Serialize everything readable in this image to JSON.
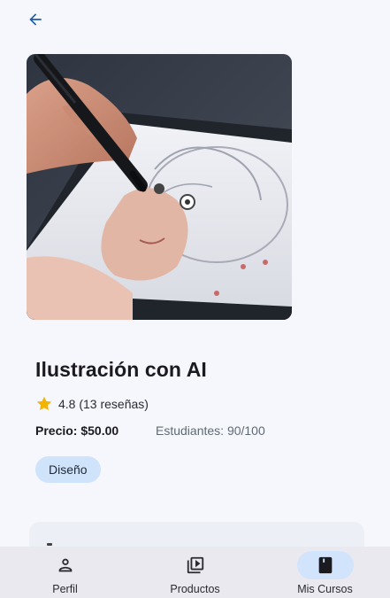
{
  "header": {
    "back_icon": "arrow-back-icon"
  },
  "course": {
    "image_alt": "Ilustración con AI",
    "title": "Ilustración con AI",
    "rating_icon": "star-icon",
    "rating_text": "4.8 (13 reseñas)",
    "price_text": "Precio: $50.00",
    "students_text": "Estudiantes: 90/100",
    "category_chip": "Diseño"
  },
  "bottom_nav": {
    "items": [
      {
        "label": "Perfil",
        "icon": "person-icon",
        "active": false
      },
      {
        "label": "Productos",
        "icon": "video-library-icon",
        "active": false
      },
      {
        "label": "Mis Cursos",
        "icon": "book-icon",
        "active": true
      }
    ]
  },
  "colors": {
    "accent": "#1f5aa6",
    "chip_bg": "#cfe3fb",
    "nav_active_bg": "#d2e4fb",
    "star": "#f3b400",
    "background": "#f6f7fc"
  }
}
